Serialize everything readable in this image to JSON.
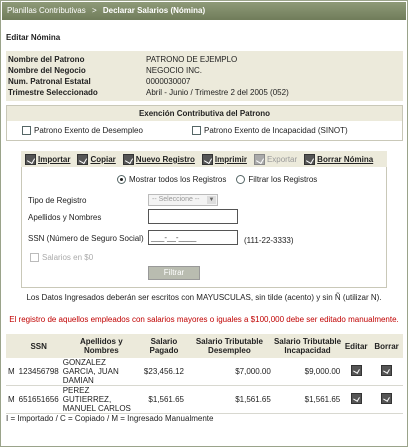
{
  "breadcrumb": {
    "parent": "Planillas Contributivas",
    "separator": ">",
    "current": "Declarar Salarios (Nómina)"
  },
  "page_title": "Editar Nómina",
  "info": {
    "rows": [
      {
        "label": "Nombre del Patrono",
        "value": "PATRONO DE EJEMPLO"
      },
      {
        "label": "Nombre del Negocio",
        "value": "NEGOCIO INC."
      },
      {
        "label": "Num. Patronal Estatal",
        "value": "0000030007"
      },
      {
        "label": "Trimestre Seleccionado",
        "value": "Abril - Junio / Trimestre 2 del 2005 (052)"
      }
    ]
  },
  "exencion": {
    "title": "Exención Contributiva del Patrono",
    "desempleo_label": "Patrono Exento de Desempleo",
    "incapacidad_label": "Patrono Exento de Incapacidad (SINOT)"
  },
  "toolbar": {
    "importar": "Importar",
    "copiar": "Copiar",
    "nuevo": "Nuevo Registro",
    "imprimir": "Imprimir",
    "exportar": "Exportar",
    "borrar": "Borrar Nómina"
  },
  "filters": {
    "radio_all": "Mostrar todos los Registros",
    "radio_filter": "Filtrar los Registros",
    "tipo_label": "Tipo de Registro",
    "tipo_value": "-- Seleccione --",
    "nombre_label": "Apellidos y Nombres",
    "nombre_value": "",
    "ssn_label": "SSN (Número de Seguro Social)",
    "ssn_value": "___-__-____",
    "ssn_hint": "(111-22-3333)",
    "salarios0_label": "Salarios en $0",
    "filtrar_label": "Filtrar"
  },
  "notes": {
    "uppercase": "Los Datos Ingresados deberán ser escritos con MAYUSCULAS, sin tilde (acento) y sin Ñ (utilizar N).",
    "warning": "El registro de aquellos empleados con salarios mayores o iguales a $100,000 debe ser editado manualmente."
  },
  "table": {
    "headers": {
      "ssn": "SSN",
      "nombre": "Apellidos y Nombres",
      "salario": "Salario Pagado",
      "desempleo": "Salario Tributable Desempleo",
      "incapacidad": "Salario Tributable Incapacidad",
      "editar": "Editar",
      "borrar": "Borrar"
    },
    "rows": [
      {
        "tipo": "M",
        "ssn": "123456798",
        "nombre": "GONZALEZ GARCIA, JUAN DAMIAN",
        "salario": "$23,456.12",
        "desempleo": "$7,000.00",
        "incapacidad": "$9,000.00"
      },
      {
        "tipo": "M",
        "ssn": "651651656",
        "nombre": "PEREZ GUTIERREZ, MANUEL CARLOS",
        "salario": "$1,561.65",
        "desempleo": "$1,561.65",
        "incapacidad": "$1,561.65"
      }
    ]
  },
  "legend": "I = Importado / C = Copiado / M = Ingresado Manualmente"
}
